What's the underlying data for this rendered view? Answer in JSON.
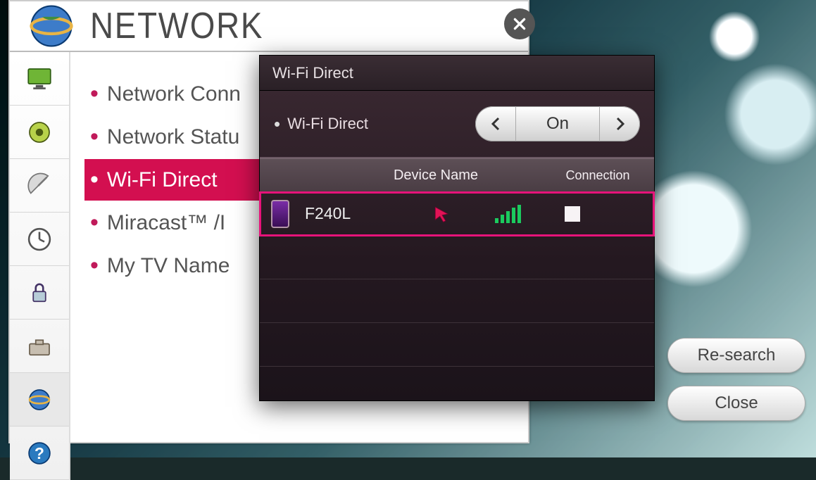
{
  "settings": {
    "title": "NETWORK",
    "menu": [
      {
        "label": "Network Conn"
      },
      {
        "label": "Network Statu"
      },
      {
        "label": "Wi-Fi Direct"
      },
      {
        "label": "Miracast™ /I"
      },
      {
        "label": "My TV Name"
      }
    ],
    "selected_index": 2
  },
  "popup": {
    "title": "Wi-Fi Direct",
    "toggle_label": "Wi-Fi Direct",
    "toggle_value": "On",
    "columns": {
      "name": "Device Name",
      "conn": "Connection"
    },
    "devices": [
      {
        "name": "F240L",
        "signal": 5,
        "connected": false,
        "highlight": true
      }
    ]
  },
  "buttons": {
    "research": "Re-search",
    "close": "Close"
  }
}
